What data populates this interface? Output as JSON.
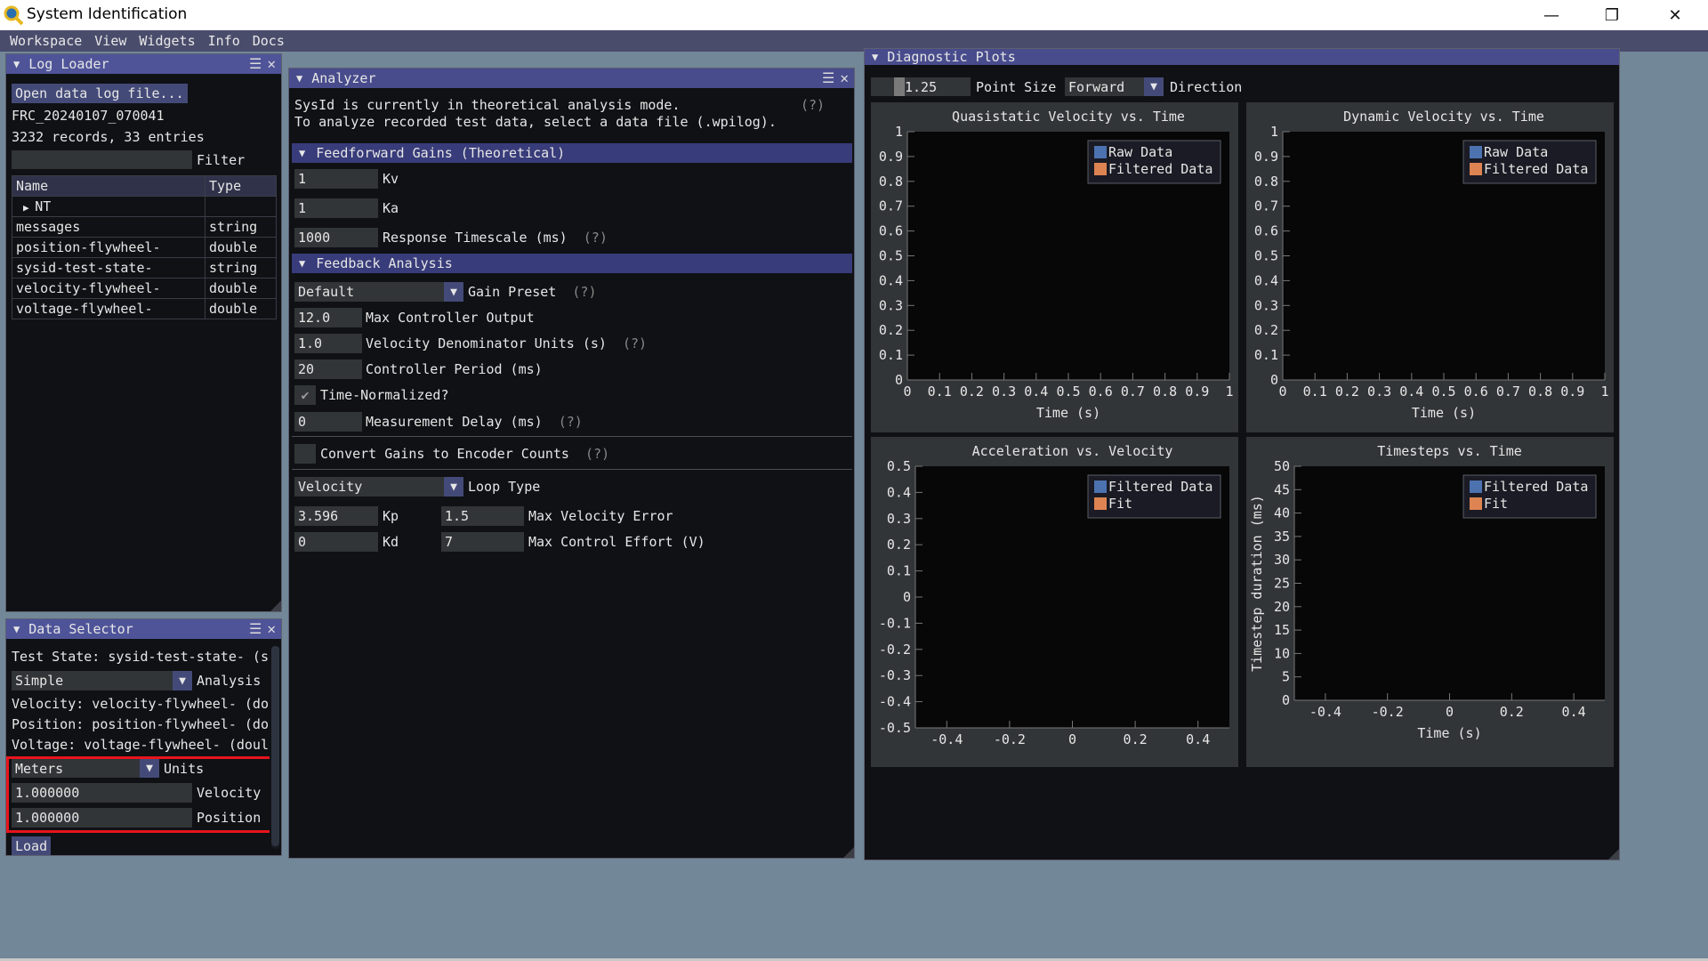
{
  "app": {
    "title": "System Identification",
    "controls": {
      "minimize": "—",
      "restore": "❐",
      "close": "✕"
    }
  },
  "menu": [
    "Workspace",
    "View",
    "Widgets",
    "Info",
    "Docs"
  ],
  "log_loader": {
    "title": "Log Loader",
    "open_button": "Open data log file...",
    "file_name": "FRC_20240107_070041",
    "summary": "3232 records, 33 entries",
    "filter_label": "Filter",
    "filter_value": "",
    "columns": [
      "Name",
      "Type"
    ],
    "rows": [
      {
        "name": "NT",
        "type": "",
        "tree": true
      },
      {
        "name": "messages",
        "type": "string"
      },
      {
        "name": "position-flywheel-",
        "type": "double"
      },
      {
        "name": "sysid-test-state-",
        "type": "string"
      },
      {
        "name": "velocity-flywheel-",
        "type": "double"
      },
      {
        "name": "voltage-flywheel-",
        "type": "double"
      }
    ]
  },
  "data_selector": {
    "title": "Data Selector",
    "test_state": "Test State: sysid-test-state- (s",
    "analysis_value": "Simple",
    "analysis_label": "Analysis",
    "velocity": "Velocity: velocity-flywheel- (do",
    "position": "Position: position-flywheel- (do",
    "voltage": "Voltage: voltage-flywheel- (doul",
    "units_value": "Meters",
    "units_label": "Units",
    "velocity_scale": "1.000000",
    "velocity_scale_label": "Velocity",
    "position_scale": "1.000000",
    "position_scale_label": "Position",
    "load_button": "Load",
    "highlight_color": "#e8141c"
  },
  "analyzer": {
    "title": "Analyzer",
    "mode_line1": "SysId is currently in theoretical analysis mode.",
    "mode_line2": "To analyze recorded test data, select a data file (.wpilog).",
    "help": "(?)",
    "ff_header": "Feedforward Gains (Theoretical)",
    "kv": "1",
    "kv_label": "Kv",
    "ka": "1",
    "ka_label": "Ka",
    "timescale": "1000",
    "timescale_label": "Response Timescale (ms)",
    "fb_header": "Feedback Analysis",
    "gain_preset": "Default",
    "gain_preset_label": "Gain Preset",
    "max_output": "12.0",
    "max_output_label": "Max Controller Output",
    "vel_denom": "1.0",
    "vel_denom_label": "Velocity Denominator Units (s)",
    "period": "20",
    "period_label": "Controller Period (ms)",
    "time_normalized_label": "Time-Normalized?",
    "time_normalized": true,
    "delay": "0",
    "delay_label": "Measurement Delay (ms)",
    "convert_label": "Convert Gains to Encoder Counts",
    "convert": false,
    "loop_type": "Velocity",
    "loop_type_label": "Loop Type",
    "kp": "3.596",
    "kp_label": "Kp",
    "kd": "0",
    "kd_label": "Kd",
    "max_vel_err": "1.5",
    "max_vel_err_label": "Max Velocity Error",
    "max_effort": "7",
    "max_effort_label": "Max Control Effort (V)"
  },
  "diagnostics": {
    "title": "Diagnostic Plots",
    "point_size": "1.25",
    "point_size_label": "Point Size",
    "direction": "Forward",
    "direction_label": "Direction"
  },
  "colors": {
    "series_blue": "#4c72b0",
    "series_orange": "#dd8452"
  },
  "chart_data": [
    {
      "type": "scatter",
      "title": "Quasistatic Velocity vs. Time",
      "xlabel": "Time (s)",
      "ylabel": "",
      "xlim": [
        0,
        1
      ],
      "ylim": [
        0,
        1
      ],
      "xticks": [
        "0",
        "0.1",
        "0.2",
        "0.3",
        "0.4",
        "0.5",
        "0.6",
        "0.7",
        "0.8",
        "0.9",
        "1"
      ],
      "yticks": [
        "0",
        "0.1",
        "0.2",
        "0.3",
        "0.4",
        "0.5",
        "0.6",
        "0.7",
        "0.8",
        "0.9",
        "1"
      ],
      "legend": [
        "Raw Data",
        "Filtered Data"
      ],
      "legend_position": "top-right",
      "series": []
    },
    {
      "type": "scatter",
      "title": "Dynamic Velocity vs. Time",
      "xlabel": "Time (s)",
      "ylabel": "",
      "xlim": [
        0,
        1
      ],
      "ylim": [
        0,
        1
      ],
      "xticks": [
        "0",
        "0.1",
        "0.2",
        "0.3",
        "0.4",
        "0.5",
        "0.6",
        "0.7",
        "0.8",
        "0.9",
        "1"
      ],
      "yticks": [
        "0",
        "0.1",
        "0.2",
        "0.3",
        "0.4",
        "0.5",
        "0.6",
        "0.7",
        "0.8",
        "0.9",
        "1"
      ],
      "legend": [
        "Raw Data",
        "Filtered Data"
      ],
      "legend_position": "top-right",
      "series": []
    },
    {
      "type": "scatter",
      "title": "Acceleration vs. Velocity",
      "xlabel": "",
      "ylabel": "",
      "xlim": [
        -0.5,
        0.5
      ],
      "ylim": [
        -0.5,
        0.5
      ],
      "xticks": [
        "-0.4",
        "-0.2",
        "0",
        "0.2",
        "0.4"
      ],
      "yticks": [
        "-0.5",
        "-0.4",
        "-0.3",
        "-0.2",
        "-0.1",
        "0",
        "0.1",
        "0.2",
        "0.3",
        "0.4",
        "0.5"
      ],
      "legend": [
        "Filtered Data",
        "Fit"
      ],
      "legend_position": "top-right",
      "series": []
    },
    {
      "type": "scatter",
      "title": "Timesteps vs. Time",
      "xlabel": "Time (s)",
      "ylabel": "Timestep duration (ms)",
      "xlim": [
        -0.5,
        0.5
      ],
      "ylim": [
        0,
        50
      ],
      "xticks": [
        "-0.4",
        "-0.2",
        "0",
        "0.2",
        "0.4"
      ],
      "yticks": [
        "0",
        "5",
        "10",
        "15",
        "20",
        "25",
        "30",
        "35",
        "40",
        "45",
        "50"
      ],
      "legend": [
        "Filtered Data",
        "Fit"
      ],
      "legend_position": "top-right",
      "series": []
    }
  ]
}
